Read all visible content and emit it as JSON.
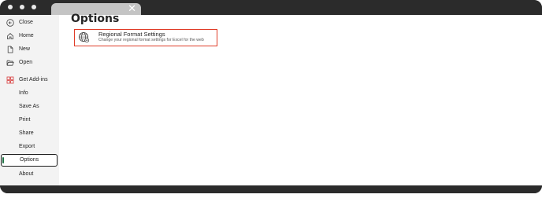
{
  "titlebar": {
    "tab_close_icon": "close-icon"
  },
  "sidebar": {
    "items": [
      {
        "label": "Close",
        "icon": "back-arrow-icon"
      },
      {
        "label": "Home",
        "icon": "home-icon"
      },
      {
        "label": "New",
        "icon": "new-document-icon"
      },
      {
        "label": "Open",
        "icon": "folder-open-icon"
      },
      {
        "label": "Get Add-ins",
        "icon": "add-ins-icon"
      },
      {
        "label": "Info"
      },
      {
        "label": "Save As"
      },
      {
        "label": "Print"
      },
      {
        "label": "Share"
      },
      {
        "label": "Export"
      },
      {
        "label": "Options",
        "selected": true
      },
      {
        "label": "About"
      }
    ]
  },
  "main": {
    "title": "Options",
    "options": [
      {
        "title": "Regional Format Settings",
        "description": "Change your regional format settings for Excel for the web",
        "icon": "globe-settings-icon"
      }
    ]
  },
  "colors": {
    "highlight_border": "#e03c28",
    "selected_accent": "#217346",
    "addins_icon": "#d83b3b"
  }
}
